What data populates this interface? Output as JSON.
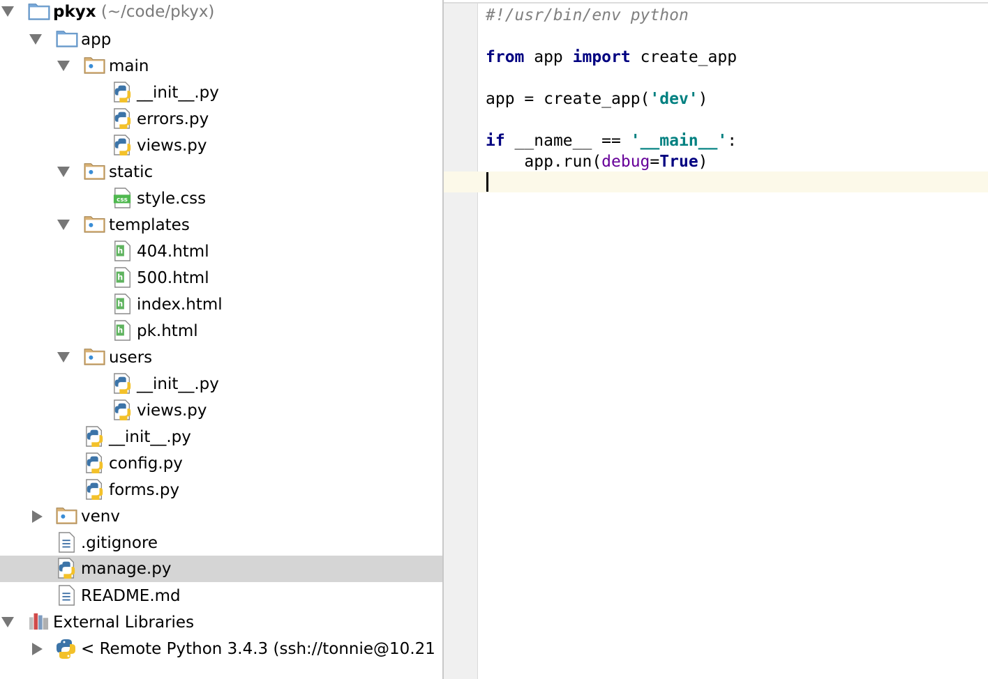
{
  "project_tree": {
    "root": {
      "name": "pkyx",
      "path": " (~/code/pkyx)"
    },
    "items": {
      "app": "app",
      "main": "main",
      "main_init": "__init__.py",
      "main_errors": "errors.py",
      "main_views": "views.py",
      "static": "static",
      "style_css": "style.css",
      "templates": "templates",
      "t_404": "404.html",
      "t_500": "500.html",
      "t_index": "index.html",
      "t_pk": "pk.html",
      "users": "users",
      "users_init": "__init__.py",
      "users_views": "views.py",
      "app_init": "__init__.py",
      "config": "config.py",
      "forms": "forms.py",
      "venv": "venv",
      "gitignore": ".gitignore",
      "manage": "manage.py",
      "readme": "README.md",
      "external_libraries": "External Libraries",
      "remote_python": "< Remote Python 3.4.3 (ssh://tonnie@10.21"
    },
    "selected_item": "manage.py"
  },
  "editor": {
    "line1": {
      "comment": "#!/usr/bin/env python"
    },
    "line3": {
      "kw_from": "from",
      "mod": " app ",
      "kw_import": "import",
      "name": " create_app"
    },
    "line5": {
      "pre": "app = create_app(",
      "str": "'dev'",
      "post": ")"
    },
    "line7": {
      "kw_if": "if",
      "mid": " __name__ == ",
      "str": "'__main__'",
      "post": ":"
    },
    "line8": {
      "pre": "    app.run(",
      "param": "debug",
      "eq": "=",
      "kw_true": "True",
      "post": ")"
    }
  },
  "colors": {
    "keyword": "#000080",
    "string": "#008080",
    "comment": "#808080",
    "param": "#660099",
    "selection": "#d5d5d5",
    "caret_line": "#fcf9e9"
  }
}
